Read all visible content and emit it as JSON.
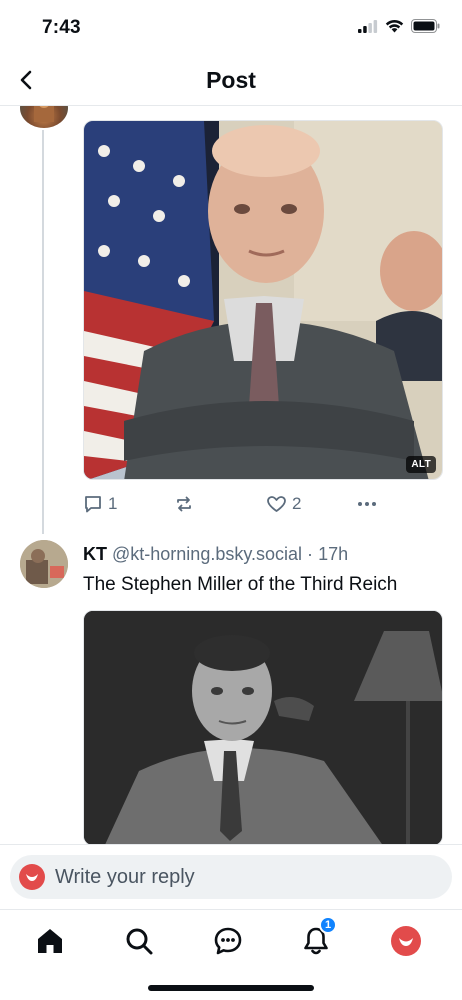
{
  "status_bar": {
    "time": "7:43",
    "icons": [
      "signal-icon",
      "wifi-icon",
      "battery-icon"
    ]
  },
  "header": {
    "title": "Post",
    "back_icon": "chevron-left-icon"
  },
  "post1": {
    "image_alt_badge": "ALT",
    "actions": {
      "reply_count": "1",
      "repost_count": "",
      "like_count": "2"
    }
  },
  "post2": {
    "display_name": "KT",
    "handle": "@kt-horning.bsky.social",
    "separator": "·",
    "time": "17h",
    "text": "The Stephen Miller of the Third Reich"
  },
  "reply_bar": {
    "placeholder": "Write your reply"
  },
  "tab_bar": {
    "items": [
      "home-icon",
      "search-icon",
      "chat-icon",
      "bell-icon",
      "profile-avatar"
    ],
    "notification_count": "1"
  },
  "colors": {
    "accent_blue": "#1083fe",
    "muted_text": "#5b6b7c",
    "avatar_red": "#e24b4b",
    "divider": "#e6e9ec"
  }
}
